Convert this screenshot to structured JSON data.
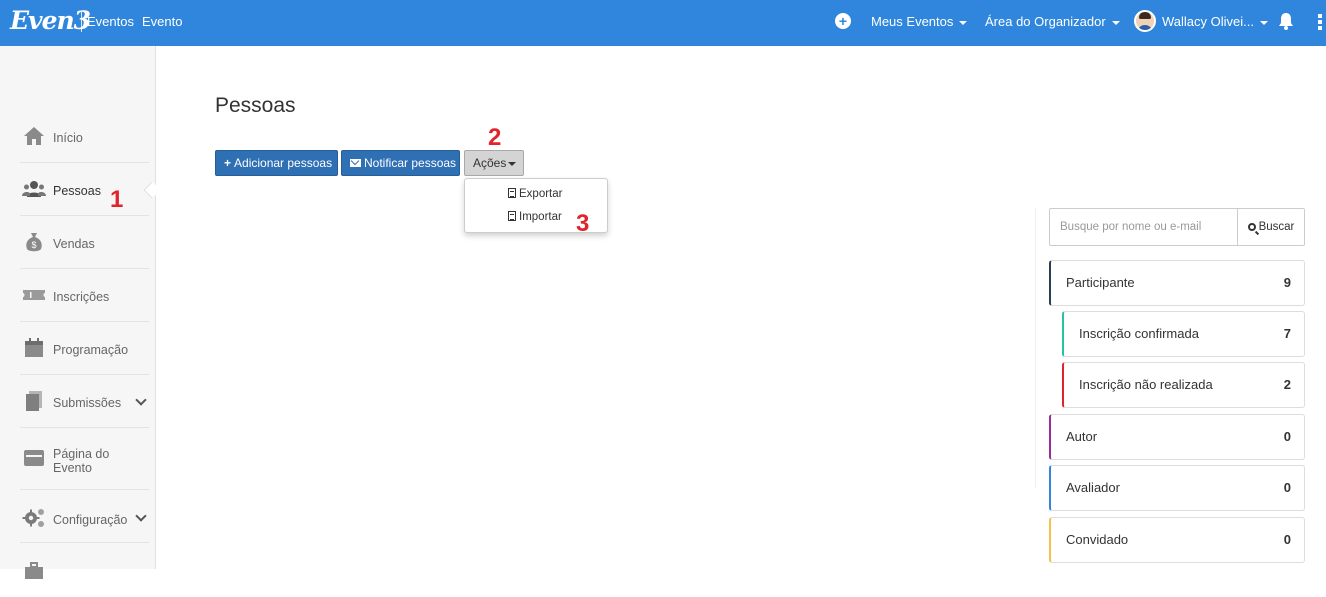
{
  "topbar": {
    "logo": "Even3",
    "links": [
      "Eventos",
      "Evento"
    ],
    "meus_eventos": "Meus Eventos",
    "area_organizador": "Área do Organizador",
    "user_name": "Wallacy Olivei..."
  },
  "sidebar": {
    "items": [
      {
        "label": "Início",
        "icon": "home-icon"
      },
      {
        "label": "Pessoas",
        "icon": "users-icon"
      },
      {
        "label": "Vendas",
        "icon": "money-bag-icon"
      },
      {
        "label": "Inscrições",
        "icon": "ticket-icon"
      },
      {
        "label": "Programação",
        "icon": "calendar-icon"
      },
      {
        "label": "Submissões",
        "icon": "documents-icon"
      },
      {
        "label": "Página do Evento",
        "icon": "browser-icon"
      },
      {
        "label": "Configuração",
        "icon": "gears-icon"
      }
    ]
  },
  "main": {
    "title": "Pessoas",
    "buttons": {
      "add": "Adicionar pessoas",
      "notify": "Notificar pessoas",
      "actions": "Ações"
    },
    "actions_menu": [
      "Exportar",
      "Importar"
    ]
  },
  "annotations": [
    "1",
    "2",
    "3"
  ],
  "right_panel": {
    "search_placeholder": "Busque por nome ou e-mail",
    "search_button": "Buscar",
    "filters": [
      {
        "label": "Participante",
        "count": "9",
        "color": "#2c3e50"
      },
      {
        "label": "Inscrição confirmada",
        "count": "7",
        "color": "#27c2a4"
      },
      {
        "label": "Inscrição não realizada",
        "count": "2",
        "color": "#e0242a"
      },
      {
        "label": "Autor",
        "count": "0",
        "color": "#9b2ca0"
      },
      {
        "label": "Avaliador",
        "count": "0",
        "color": "#2f86dc"
      },
      {
        "label": "Convidado",
        "count": "0",
        "color": "#f2c14e"
      }
    ]
  },
  "colors": {
    "brand": "#2f86dc",
    "primary_button": "#2f6fb4",
    "annotation": "#e0242a"
  }
}
